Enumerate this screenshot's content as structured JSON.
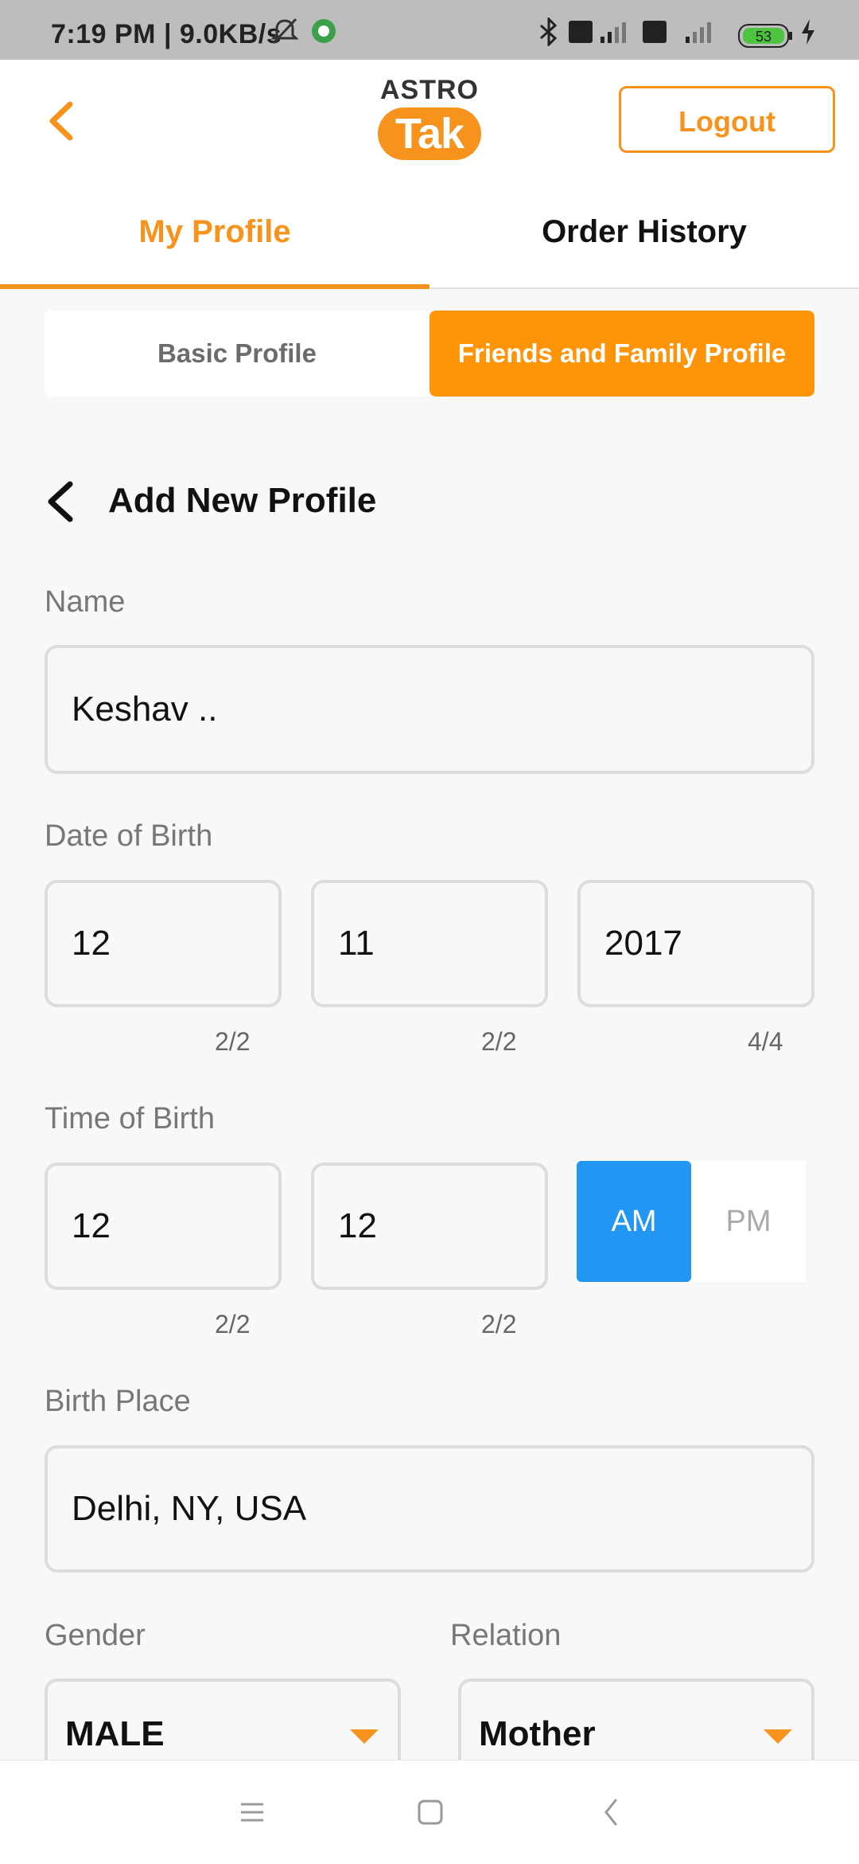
{
  "status_bar": {
    "time": "7:19 PM | 9.0KB/s",
    "battery": "53"
  },
  "header": {
    "logo_top": "ASTRO",
    "logo_bottom": "Tak",
    "logout_label": "Logout"
  },
  "tabs": [
    {
      "label": "My Profile",
      "active": true
    },
    {
      "label": "Order History",
      "active": false
    }
  ],
  "profile_toggle": {
    "basic_label": "Basic Profile",
    "family_label": "Friends and Family Profile"
  },
  "form": {
    "title": "Add New Profile",
    "name_label": "Name",
    "name_value": "Keshav ..",
    "dob_label": "Date of Birth",
    "dob_day": "12",
    "dob_month": "11",
    "dob_year": "2017",
    "dob_day_counter": "2/2",
    "dob_month_counter": "2/2",
    "dob_year_counter": "4/4",
    "tob_label": "Time of Birth",
    "tob_hour": "12",
    "tob_minute": "12",
    "tob_hour_counter": "2/2",
    "tob_minute_counter": "2/2",
    "am_label": "AM",
    "pm_label": "PM",
    "birth_place_label": "Birth Place",
    "birth_place_value": "Delhi, NY, USA",
    "gender_label": "Gender",
    "gender_value": "MALE",
    "relation_label": "Relation",
    "relation_value": "Mother"
  },
  "colors": {
    "accent": "#f7931d",
    "am_selected": "#2196f3"
  }
}
